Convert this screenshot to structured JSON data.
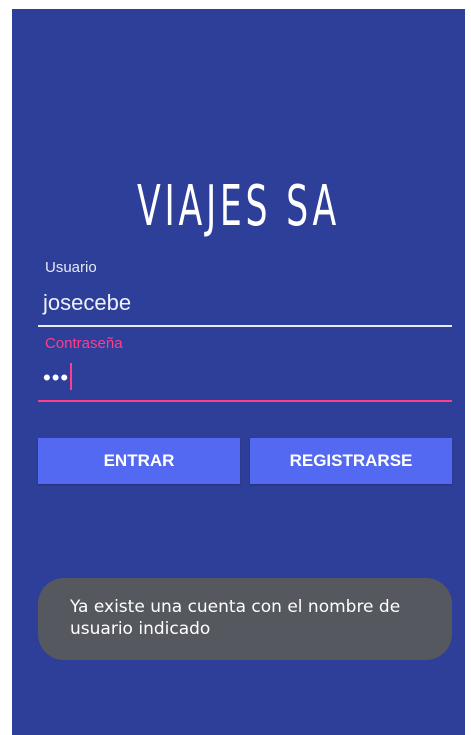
{
  "app": {
    "title": "VIAJES SA",
    "colors": {
      "background": "#2e3f9a",
      "accent": "#ff3d8b",
      "button": "#5469f2",
      "toast": "#56585f"
    }
  },
  "form": {
    "username": {
      "label": "Usuario",
      "value": "josecebe"
    },
    "password": {
      "label": "Contraseña",
      "value": "•••"
    }
  },
  "buttons": {
    "login_label": "ENTRAR",
    "register_label": "REGISTRARSE"
  },
  "toast": {
    "message": "Ya existe una cuenta con el nombre de usuario indicado"
  }
}
